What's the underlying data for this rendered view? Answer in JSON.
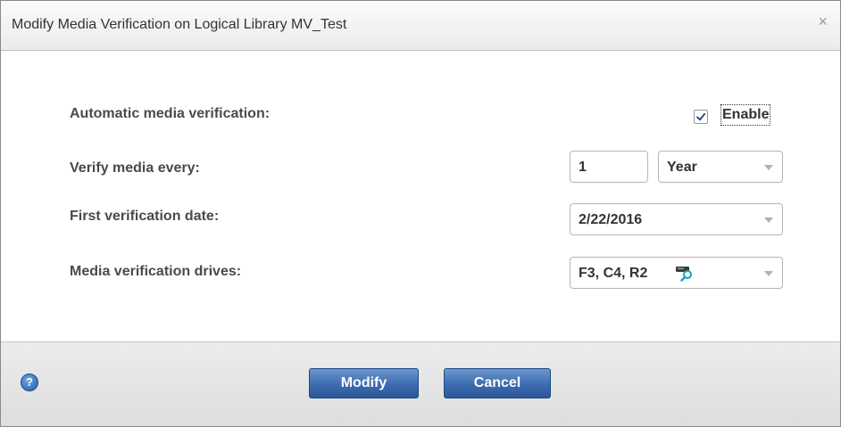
{
  "dialog": {
    "title": "Modify Media Verification on Logical Library MV_Test",
    "close_label": "×"
  },
  "form": {
    "auto_verification": {
      "label": "Automatic media verification:",
      "checkbox_label": "Enable",
      "checked": true
    },
    "verify_every": {
      "label": "Verify media every:",
      "count_value": "1",
      "unit_value": "Year"
    },
    "first_date": {
      "label": "First verification date:",
      "value": "2/22/2016"
    },
    "drives": {
      "label": "Media verification drives:",
      "value": "F3, C4, R2"
    }
  },
  "footer": {
    "help_label": "?",
    "modify_label": "Modify",
    "cancel_label": "Cancel"
  },
  "colors": {
    "button_blue": "#3c6bb0",
    "help_blue": "#1f5ea8",
    "magnifier_teal": "#1aa0c0"
  },
  "icons": {
    "drive_lookup": "drive-search-icon",
    "help": "help-icon",
    "close": "close-icon",
    "check": "checkmark-icon"
  }
}
